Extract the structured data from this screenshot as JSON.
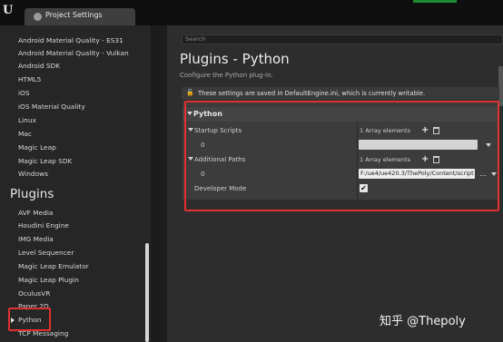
{
  "window": {
    "app_icon": "unreal-engine-logo",
    "tab_label": "Project Settings",
    "tab_icon": "settings-icon"
  },
  "sidebar": {
    "platform_items": [
      "Android Material Quality - ES31",
      "Android Material Quality - Vulkan",
      "Android SDK",
      "HTML5",
      "iOS",
      "iOS Material Quality",
      "Linux",
      "Mac",
      "Magic Leap",
      "Magic Leap SDK",
      "Windows"
    ],
    "plugins_heading": "Plugins",
    "plugin_items": [
      "AVF Media",
      "Houdini Engine",
      "IMG Media",
      "Level Sequencer",
      "Magic Leap Emulator",
      "Magic Leap Plugin",
      "OculusVR",
      "Paper 2D",
      "Python",
      "TCP Messaging"
    ],
    "selected_item": "Python"
  },
  "main": {
    "search_placeholder": "Search",
    "title": "Plugins - Python",
    "subtitle": "Configure the Python plug-in.",
    "notice": "These settings are saved in DefaultEngine.ini, which is currently writable.",
    "section_title": "Python",
    "properties": {
      "startup_scripts": {
        "label": "Startup Scripts",
        "count": "1 Array elements",
        "index": "0",
        "value": ""
      },
      "additional_paths": {
        "label": "Additional Paths",
        "count": "1 Array elements",
        "index": "0",
        "value": "F:/ue4/ue420.3/ThePoly/Content/script"
      },
      "developer_mode": {
        "label": "Developer Mode",
        "checked": true,
        "mark": "✔"
      }
    }
  },
  "watermark": "知乎 @Thepoly",
  "colors": {
    "highlight": "#e03030",
    "panel": "#3c3c3c",
    "background": "#2d2d2d"
  }
}
